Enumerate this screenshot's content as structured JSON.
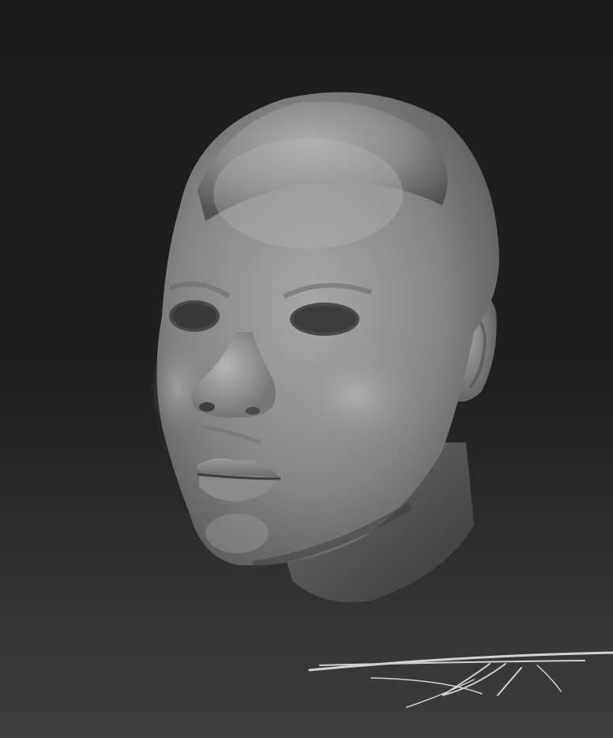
{
  "scene": {
    "subject": "sculpted-head",
    "material": "clay-gray",
    "colors": {
      "background_top": "#1d1d1d",
      "background_bottom": "#3d3d3d",
      "clay_light": "#a9a9a9",
      "clay_mid": "#7c7c7c",
      "clay_dark": "#3e3e3e",
      "signature": "#d2d2d2"
    }
  },
  "icons": [
    "signature-mark"
  ]
}
